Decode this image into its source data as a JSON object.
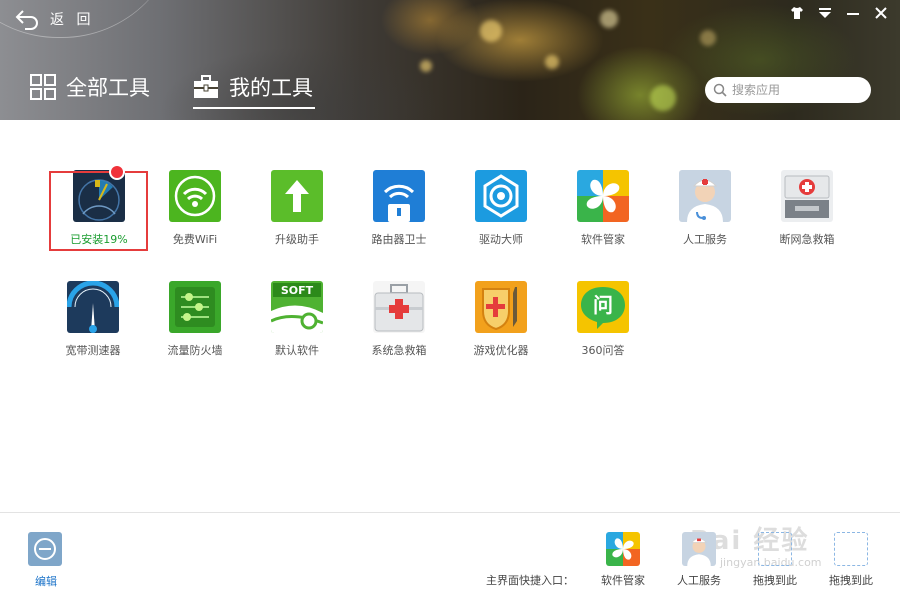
{
  "header": {
    "back_label": "返 回",
    "tabs": [
      {
        "label": "全部工具",
        "icon": "grid-icon",
        "active": false
      },
      {
        "label": "我的工具",
        "icon": "toolbox-icon",
        "active": true
      }
    ],
    "search_placeholder": "搜索应用",
    "window_controls": [
      "skin-icon",
      "menu-icon",
      "minimize-icon",
      "close-icon"
    ]
  },
  "tools": [
    {
      "label": "已安装19%",
      "icon": "broadband-radar-icon",
      "status": "installing",
      "progress_percent": 19
    },
    {
      "label": "免费WiFi",
      "icon": "wifi-icon",
      "color": "#4cb51f"
    },
    {
      "label": "升级助手",
      "icon": "upgrade-arrow-icon",
      "color": "#5bbd2a"
    },
    {
      "label": "路由器卫士",
      "icon": "router-guard-icon",
      "color": "#1f7ed6"
    },
    {
      "label": "驱动大师",
      "icon": "driver-gear-icon",
      "color": "#1c9be0"
    },
    {
      "label": "软件管家",
      "icon": "software-manager-icon",
      "color": "#2aa8e0"
    },
    {
      "label": "人工服务",
      "icon": "doctor-icon",
      "color": "#7fa0c4"
    },
    {
      "label": "断网急救箱",
      "icon": "network-firstaid-icon",
      "color": "#c9ccd0"
    },
    {
      "label": "宽带测速器",
      "icon": "speedometer-icon",
      "color": "#1d3a5c"
    },
    {
      "label": "流量防火墙",
      "icon": "traffic-firewall-icon",
      "color": "#3aa72a"
    },
    {
      "label": "默认软件",
      "icon": "soft-default-icon",
      "color": "#4fb232"
    },
    {
      "label": "系统急救箱",
      "icon": "system-firstaid-icon",
      "color": "#e6e6e6"
    },
    {
      "label": "游戏优化器",
      "icon": "game-optimizer-icon",
      "color": "#f2a11c"
    },
    {
      "label": "360问答",
      "icon": "qa-icon",
      "color": "#f5c400"
    }
  ],
  "footer": {
    "edit_label": "编辑",
    "shortcut_title": "主界面快捷入口：",
    "slots": [
      {
        "label": "软件管家",
        "icon": "software-manager-icon"
      },
      {
        "label": "人工服务",
        "icon": "doctor-icon"
      },
      {
        "label": "拖拽到此",
        "icon": "empty-slot-icon"
      },
      {
        "label": "拖拽到此",
        "icon": "empty-slot-icon"
      }
    ]
  },
  "watermark": {
    "main": "Bai 经验",
    "sub": "jingyan.baidu.com"
  }
}
